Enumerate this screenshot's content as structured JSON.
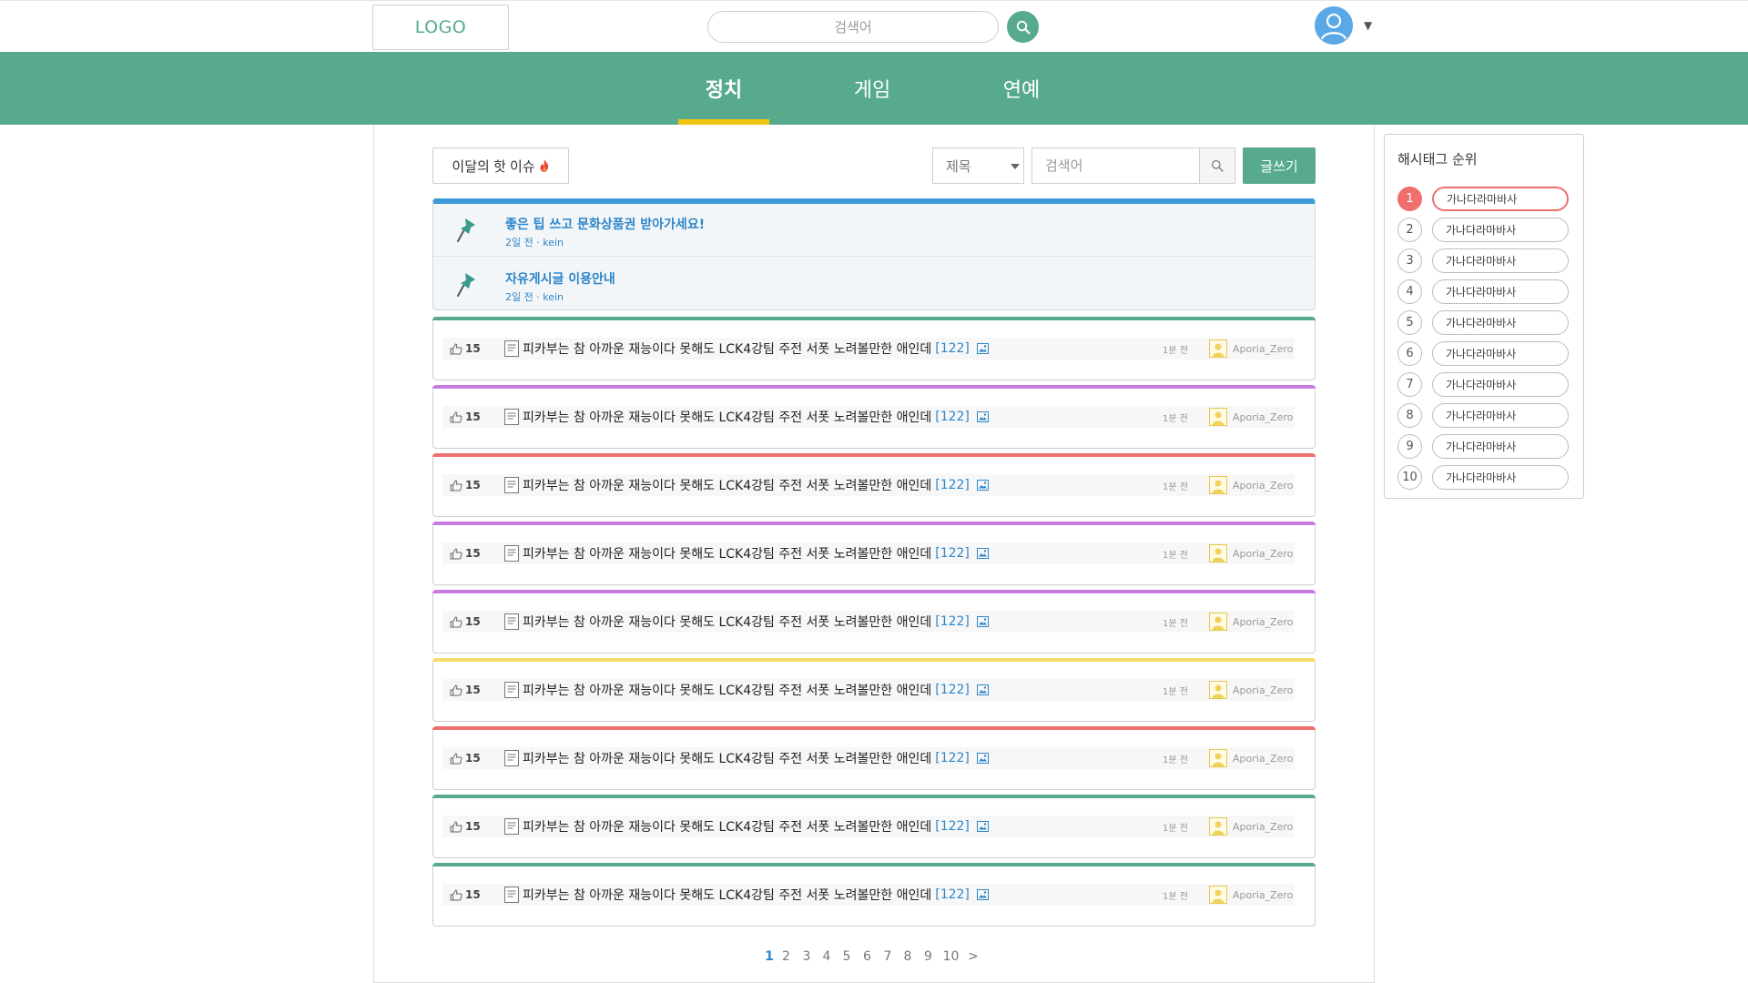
{
  "header": {
    "logo_text": "LOGO",
    "search_placeholder": "검색어",
    "search_icon": "search-icon",
    "avatar_icon": "user-avatar-icon",
    "caret": "▼"
  },
  "nav": {
    "tabs": [
      {
        "label": "정치",
        "active": true
      },
      {
        "label": "게임",
        "active": false
      },
      {
        "label": "연예",
        "active": false
      }
    ],
    "accent": "#57ab8c",
    "underline_color": "#f1c40f"
  },
  "toolbar": {
    "hot_issue_label": "이달의 핫 이슈",
    "hot_icon": "fire-icon",
    "select_value": "제목",
    "search_placeholder": "검색어",
    "write_label": "글쓰기"
  },
  "notices": [
    {
      "title": "좋은 팁 쓰고 문화상품권 받아가세요!",
      "time": "2일 전",
      "author": "kein"
    },
    {
      "title": "자유게시글 이용안내",
      "time": "2일 전",
      "author": "kein"
    }
  ],
  "posts": [
    {
      "likes": "15",
      "title": "피카부는 참 아까운 재능이다 못해도 LCK4강팀 주전 서폿 노려볼만한 애인데",
      "comments": "[122]",
      "time": "1분 전",
      "author": "Aporia_Zero",
      "bar_color": "#57ab8c"
    },
    {
      "likes": "15",
      "title": "피카부는 참 아까운 재능이다 못해도 LCK4강팀 주전 서폿 노려볼만한 애인데",
      "comments": "[122]",
      "time": "1분 전",
      "author": "Aporia_Zero",
      "bar_color": "#c77be0"
    },
    {
      "likes": "15",
      "title": "피카부는 참 아까운 재능이다 못해도 LCK4강팀 주전 서폿 노려볼만한 애인데",
      "comments": "[122]",
      "time": "1분 전",
      "author": "Aporia_Zero",
      "bar_color": "#ef6f6c"
    },
    {
      "likes": "15",
      "title": "피카부는 참 아까운 재능이다 못해도 LCK4강팀 주전 서폿 노려볼만한 애인데",
      "comments": "[122]",
      "time": "1분 전",
      "author": "Aporia_Zero",
      "bar_color": "#c77be0"
    },
    {
      "likes": "15",
      "title": "피카부는 참 아까운 재능이다 못해도 LCK4강팀 주전 서폿 노려볼만한 애인데",
      "comments": "[122]",
      "time": "1분 전",
      "author": "Aporia_Zero",
      "bar_color": "#c77be0"
    },
    {
      "likes": "15",
      "title": "피카부는 참 아까운 재능이다 못해도 LCK4강팀 주전 서폿 노려볼만한 애인데",
      "comments": "[122]",
      "time": "1분 전",
      "author": "Aporia_Zero",
      "bar_color": "#f3dc6b"
    },
    {
      "likes": "15",
      "title": "피카부는 참 아까운 재능이다 못해도 LCK4강팀 주전 서폿 노려볼만한 애인데",
      "comments": "[122]",
      "time": "1분 전",
      "author": "Aporia_Zero",
      "bar_color": "#ef6f6c"
    },
    {
      "likes": "15",
      "title": "피카부는 참 아까운 재능이다 못해도 LCK4강팀 주전 서폿 노려볼만한 애인데",
      "comments": "[122]",
      "time": "1분 전",
      "author": "Aporia_Zero",
      "bar_color": "#57ab8c"
    },
    {
      "likes": "15",
      "title": "피카부는 참 아까운 재능이다 못해도 LCK4강팀 주전 서폿 노려볼만한 애인데",
      "comments": "[122]",
      "time": "1분 전",
      "author": "Aporia_Zero",
      "bar_color": "#57ab8c"
    }
  ],
  "pagination": {
    "pages": [
      "1",
      "2",
      "3",
      "4",
      "5",
      "6",
      "7",
      "8",
      "9",
      "10"
    ],
    "current": "1",
    "next": ">"
  },
  "hashtags": {
    "title": "해시태그 순위",
    "items": [
      {
        "rank": "1",
        "tag": "가나다라마바사"
      },
      {
        "rank": "2",
        "tag": "가나다라마바사"
      },
      {
        "rank": "3",
        "tag": "가나다라마바사"
      },
      {
        "rank": "4",
        "tag": "가나다라마바사"
      },
      {
        "rank": "5",
        "tag": "가나다라마바사"
      },
      {
        "rank": "6",
        "tag": "가나다라마바사"
      },
      {
        "rank": "7",
        "tag": "가나다라마바사"
      },
      {
        "rank": "8",
        "tag": "가나다라마바사"
      },
      {
        "rank": "9",
        "tag": "가나다라마바사"
      },
      {
        "rank": "10",
        "tag": "가나다라마바사"
      }
    ],
    "top_color": "#ef6f6c"
  }
}
